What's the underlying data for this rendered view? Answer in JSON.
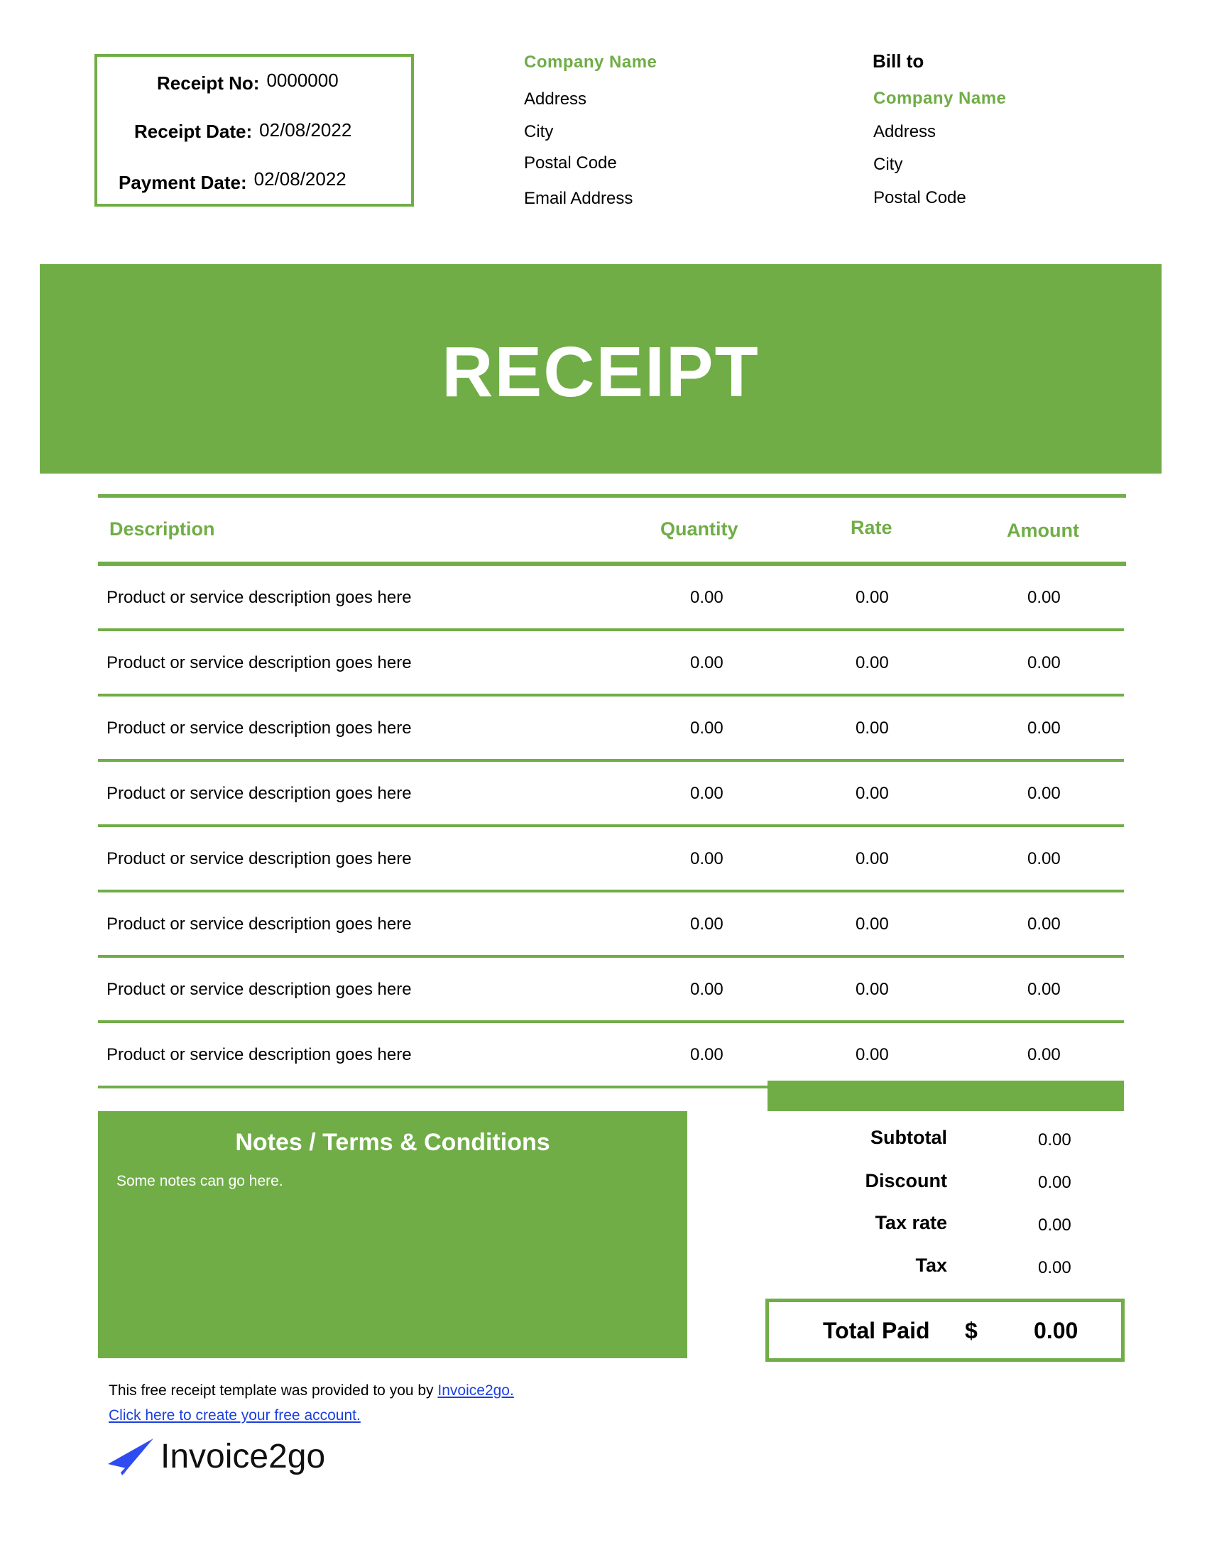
{
  "receipt_info": {
    "receipt_no_label": "Receipt No:",
    "receipt_no": "0000000",
    "receipt_date_label": "Receipt Date:",
    "receipt_date": "02/08/2022",
    "payment_date_label": "Payment Date:",
    "payment_date": "02/08/2022"
  },
  "from": {
    "company_name": "Company Name",
    "address": "Address",
    "city": "City",
    "postal_code": "Postal Code",
    "email": "Email Address"
  },
  "bill_to": {
    "heading": "Bill to",
    "company_name": "Company Name",
    "address": "Address",
    "city": "City",
    "postal_code": "Postal Code"
  },
  "banner": {
    "title": "RECEIPT"
  },
  "table": {
    "headers": {
      "description": "Description",
      "quantity": "Quantity",
      "rate": "Rate",
      "amount": "Amount"
    },
    "rows": [
      {
        "description": "Product or service description goes here",
        "quantity": "0.00",
        "rate": "0.00",
        "amount": "0.00"
      },
      {
        "description": "Product or service description goes here",
        "quantity": "0.00",
        "rate": "0.00",
        "amount": "0.00"
      },
      {
        "description": "Product or service description goes here",
        "quantity": "0.00",
        "rate": "0.00",
        "amount": "0.00"
      },
      {
        "description": "Product or service description goes here",
        "quantity": "0.00",
        "rate": "0.00",
        "amount": "0.00"
      },
      {
        "description": "Product or service description goes here",
        "quantity": "0.00",
        "rate": "0.00",
        "amount": "0.00"
      },
      {
        "description": "Product or service description goes here",
        "quantity": "0.00",
        "rate": "0.00",
        "amount": "0.00"
      },
      {
        "description": "Product or service description goes here",
        "quantity": "0.00",
        "rate": "0.00",
        "amount": "0.00"
      },
      {
        "description": "Product or service description goes here",
        "quantity": "0.00",
        "rate": "0.00",
        "amount": "0.00"
      }
    ]
  },
  "notes": {
    "title": "Notes / Terms & Conditions",
    "text": "Some notes can go here."
  },
  "totals": {
    "subtotal_label": "Subtotal",
    "subtotal": "0.00",
    "discount_label": "Discount",
    "discount": "0.00",
    "tax_rate_label": "Tax rate",
    "tax_rate": "0.00",
    "tax_label": "Tax",
    "tax": "0.00",
    "total_paid_label": "Total Paid",
    "currency": "$",
    "total_paid": "0.00"
  },
  "footer": {
    "credit_text": "This free receipt template was provided to you by ",
    "credit_link": "Invoice2go.",
    "signup_link": "Click here to create your free account.",
    "logo_text": "Invoice2go",
    "logo_icon": "paper-plane-icon"
  },
  "colors": {
    "accent": "#70AD47",
    "link": "#1B3FE0"
  }
}
